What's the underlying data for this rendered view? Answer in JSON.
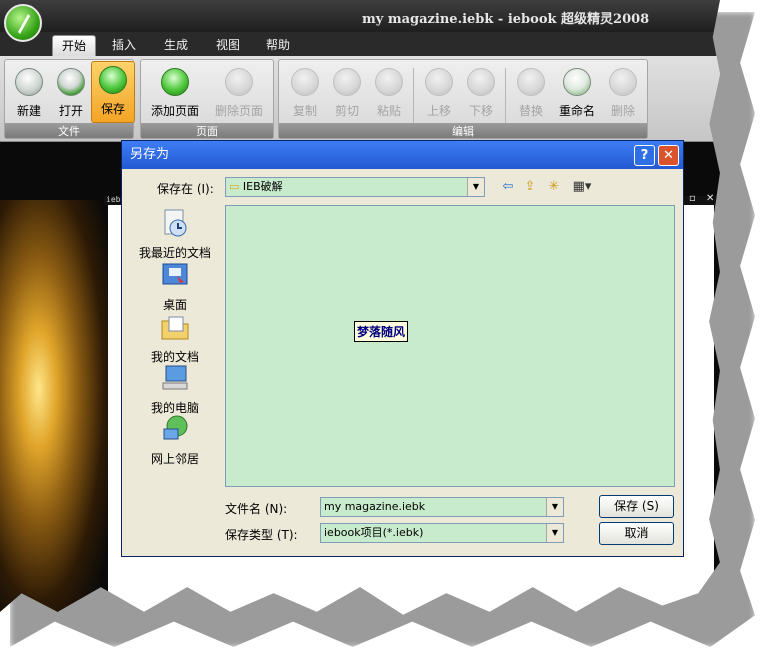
{
  "app": {
    "title": "my magazine.iebk - iebook 超级精灵2008",
    "tabs": [
      "开始",
      "插入",
      "生成",
      "视图",
      "帮助"
    ],
    "overlay_label": "iebk"
  },
  "ribbon": {
    "file_group": {
      "label": "文件",
      "buttons": [
        "新建",
        "打开",
        "保存"
      ]
    },
    "page_group": {
      "label": "页面",
      "buttons": [
        "添加页面",
        "删除页面"
      ]
    },
    "edit_group": {
      "label": "编辑",
      "buttons": [
        "复制",
        "剪切",
        "粘贴",
        "上移",
        "下移",
        "替换",
        "重命名",
        "删除"
      ]
    }
  },
  "dialog": {
    "title": "另存为",
    "save_in_label": "保存在 (I):",
    "save_in_value": "IEB破解",
    "places": [
      "我最近的文档",
      "桌面",
      "我的文档",
      "我的电脑",
      "网上邻居"
    ],
    "files": [
      "梦落随风"
    ],
    "filename_label": "文件名 (N):",
    "filename_value": "my magazine.iebk",
    "filetype_label": "保存类型 (T):",
    "filetype_value": "iebook项目(*.iebk)",
    "save_button": "保存 (S)",
    "cancel_button": "取消",
    "help_glyph": "?",
    "close_glyph": "✕"
  },
  "colors": {
    "accent": "#2359d2",
    "list_bg": "#c9ebcd",
    "selected_ribbon": "#f3a425"
  }
}
